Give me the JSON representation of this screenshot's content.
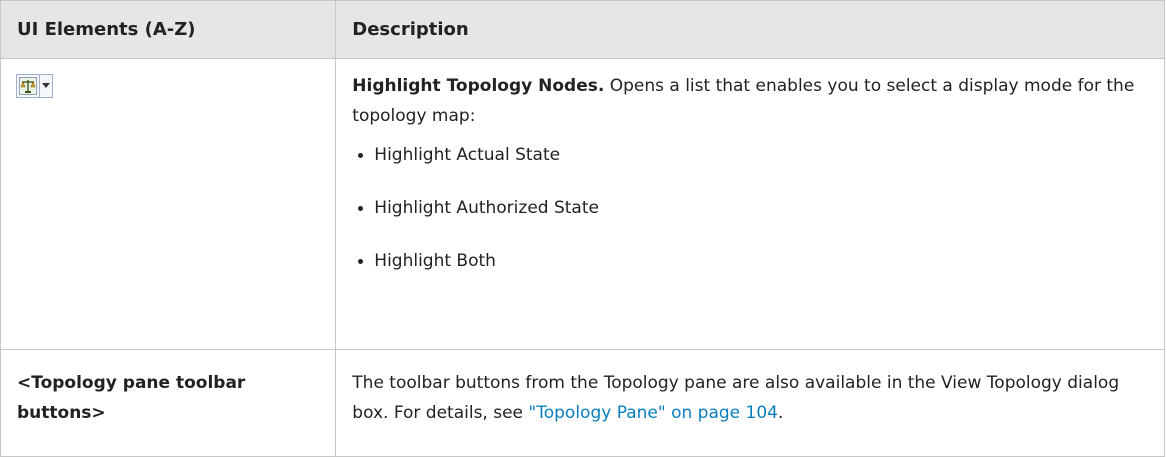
{
  "header": {
    "col1": "UI Elements (A-Z)",
    "col2": "Description"
  },
  "rows": [
    {
      "icon": "highlight-topology-nodes-icon",
      "desc_bold": "Highlight Topology Nodes.",
      "desc_text": " Opens a list that enables you to select a display mode for the topology map:",
      "bullets": [
        "Highlight Actual State",
        "Highlight Authorized State",
        "Highlight Both"
      ]
    },
    {
      "element": "<Topology pane toolbar buttons>",
      "desc_text": "The toolbar buttons from the Topology pane are also available in the View Topology dialog box. For details, see ",
      "link_text": "\"Topology Pane\" on page 104",
      "desc_end": "."
    }
  ],
  "colors": {
    "header_bg": "#e6e6e6",
    "border": "#c6c6c6",
    "link": "#0a7fbf"
  }
}
